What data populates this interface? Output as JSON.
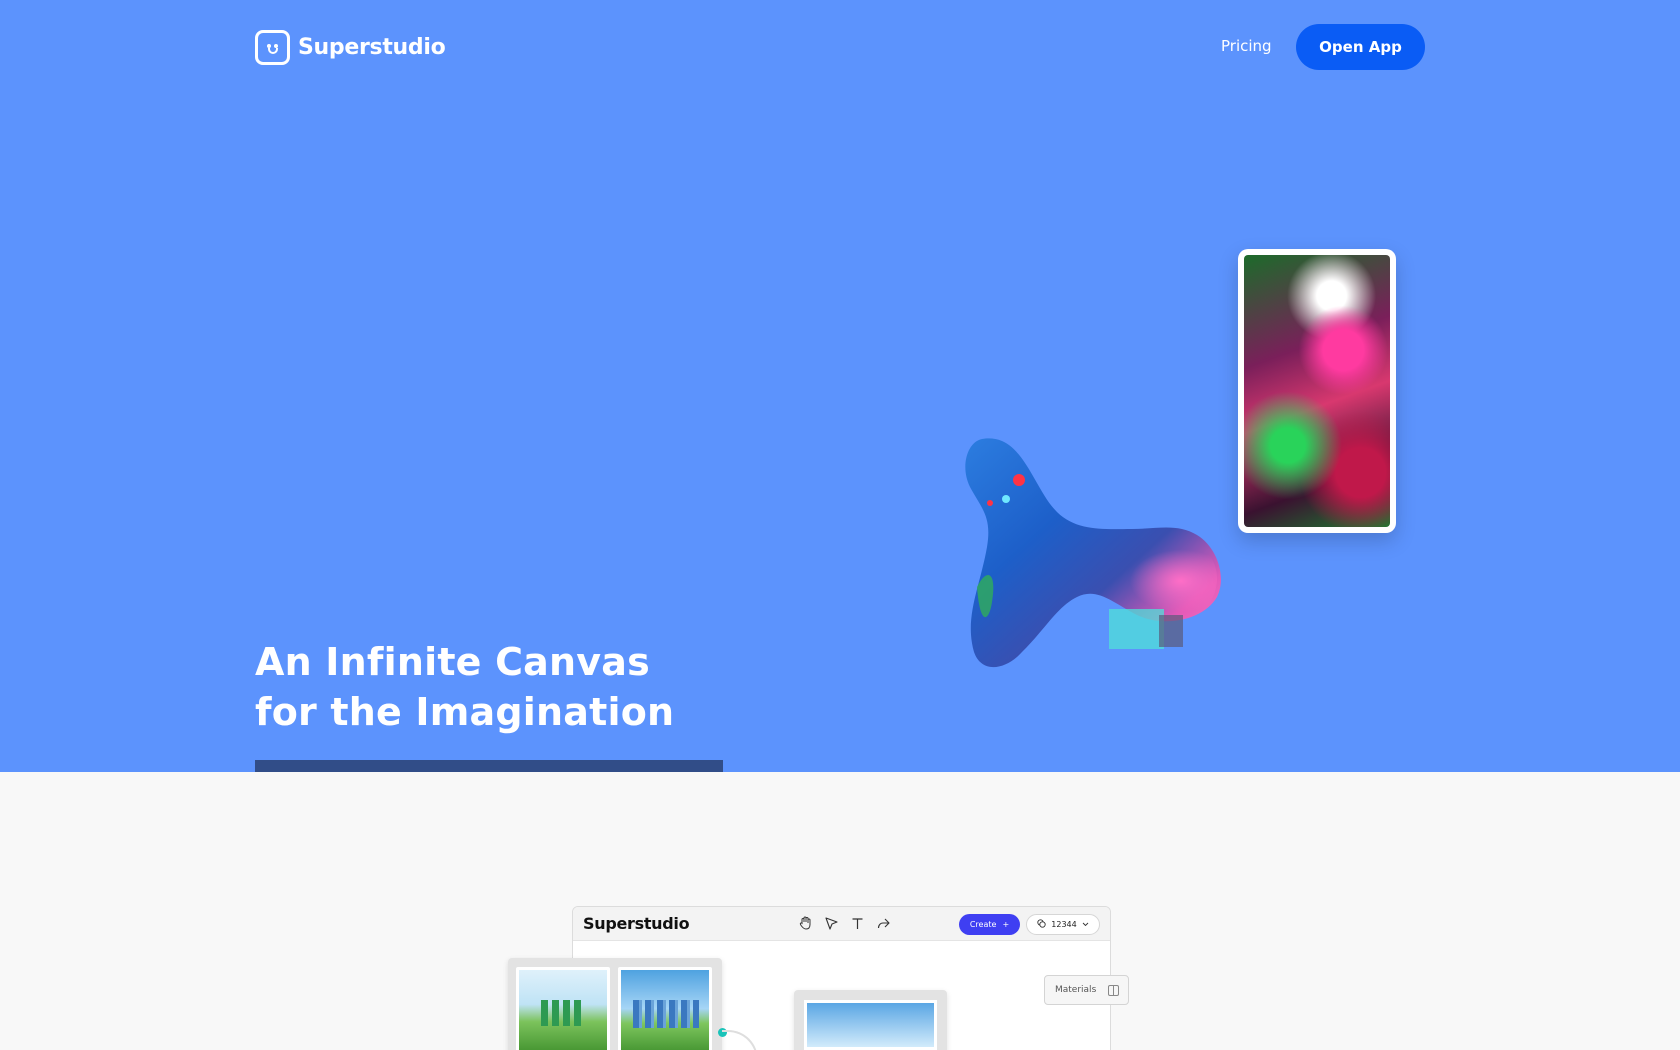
{
  "nav": {
    "brand": "Superstudio",
    "pricing": "Pricing",
    "open_app": "Open App"
  },
  "hero": {
    "title_line1": "An Infinite Canvas",
    "title_line2": "for the Imagination"
  },
  "app_preview": {
    "brand": "Superstudio",
    "tools": [
      "hand-icon",
      "pointer-icon",
      "text-icon",
      "share-icon"
    ],
    "create_label": "Create",
    "credits": "12344",
    "materials_label": "Materials"
  },
  "colors": {
    "hero_bg": "#5c93fd",
    "primary_button": "#0a5cf5",
    "create_button": "#3f3ff2",
    "page_bg": "#f8f8f8"
  }
}
